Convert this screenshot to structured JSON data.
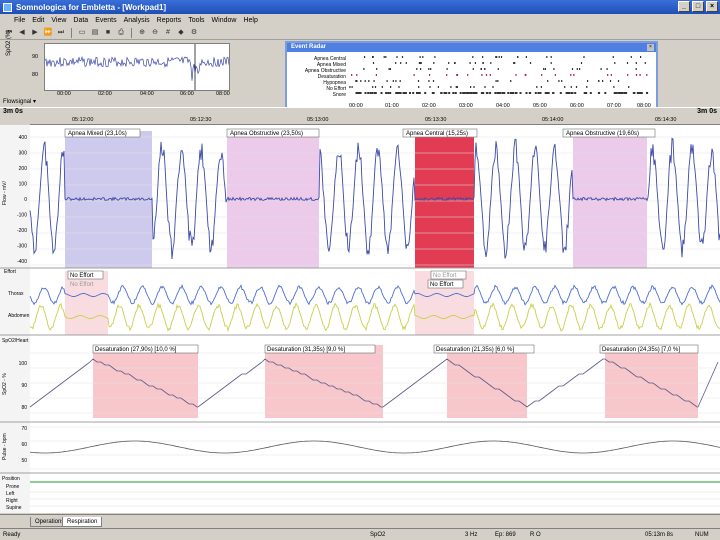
{
  "window": {
    "title": "Somnologica for Embletta - [Workpad1]",
    "buttons": {
      "minimize": "_",
      "maximize": "□",
      "close": "×"
    }
  },
  "menu": [
    "File",
    "Edit",
    "View",
    "Data",
    "Events",
    "Analysis",
    "Reports",
    "Tools",
    "Window",
    "Help"
  ],
  "overview": {
    "ylabel": "SpO2 (%)",
    "yticks": [
      "90",
      "80"
    ],
    "xticks": [
      "00:00",
      "02:00",
      "04:00",
      "06:00",
      "08:00"
    ]
  },
  "event_radar": {
    "title": "Event Radar",
    "close": "×",
    "rows": [
      "Apnea Central",
      "Apnea Mixed",
      "Apnea Obstructive",
      "Desaturation",
      "Hypopnea",
      "No Effort",
      "Snore"
    ],
    "xticks": [
      "00:00",
      "01:00",
      "02:00",
      "03:00",
      "04:00",
      "05:00",
      "06:00",
      "07:00",
      "08:00"
    ]
  },
  "flowsignal": "Flowsignal",
  "timebar": {
    "left_scale": "3m 0s",
    "right_scale": "3m 0s",
    "ticks": [
      "05:12:00",
      "05:12:30",
      "05:13:00",
      "05:13:30",
      "05:14:00",
      "05:14:30"
    ]
  },
  "channels": {
    "flow": {
      "label": "Flow - mV/",
      "yticks": [
        "400",
        "300",
        "200",
        "100",
        "0",
        "-100",
        "-200",
        "-300",
        "-400"
      ]
    },
    "effort": {
      "label": "Effort",
      "thorax": "Thorax",
      "abdomen": "Abdomen"
    },
    "spo2": {
      "label": "SpO2 - %",
      "header": "SpO2/Heart",
      "yticks": [
        "100",
        "90",
        "80"
      ]
    },
    "pulse": {
      "label": "Pulse - bpm",
      "yticks": [
        "70",
        "60",
        "50"
      ]
    },
    "position": {
      "label": "Position",
      "rows": [
        "Prone",
        "Left",
        "Right",
        "Supine"
      ]
    }
  },
  "events": {
    "apnea": [
      {
        "text": "Apnea Mixed (23,10s)",
        "color": "#b9b3e6"
      },
      {
        "text": "Apnea Obstructive (23,50s)",
        "color": "#e3b3e1"
      },
      {
        "text": "Apnea Central (15,25s)",
        "color": "#e23c55"
      },
      {
        "text": "Apnea Obstructive (19,60s)",
        "color": "#e3b3e1"
      }
    ],
    "no_effort": [
      "No Effort",
      "No Effort",
      "No Effort",
      "No Effort"
    ],
    "desaturation": [
      {
        "text": "Desaturation (27,90s) [10,0 %]"
      },
      {
        "text": "Desaturation (31,35s) [9,0 %]"
      },
      {
        "text": "Desaturation (21,35s) [6,0 %]"
      },
      {
        "text": "Desaturation (24,35s) [7,0 %]"
      }
    ]
  },
  "tabs": {
    "left": "Operations",
    "right": "Respiration"
  },
  "status": {
    "ready": "Ready",
    "signal": "SpO2",
    "rate": "3 Hz",
    "epoch": "Ep: 869",
    "code": "R O",
    "time": "05:13m 8s",
    "num": "NUM"
  },
  "colors": {
    "flow_trace": "#3c4aa8",
    "thorax_trace": "#4d6fd1",
    "abdomen_trace": "#c9cf4a",
    "grid": "#d8d8d8",
    "desat_fill": "#f7c7cb"
  }
}
